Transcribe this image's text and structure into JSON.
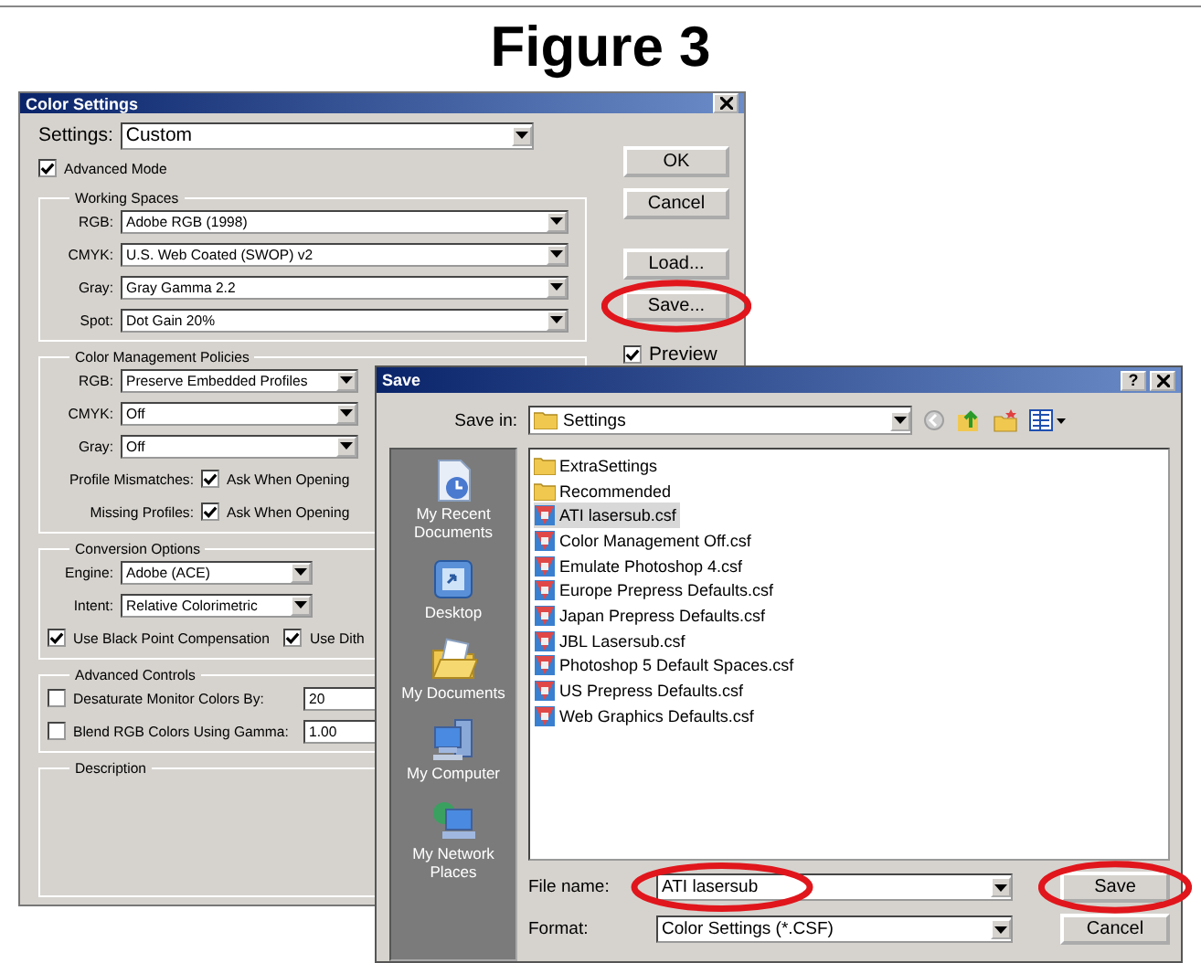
{
  "caption": "Figure 3",
  "color_settings": {
    "title": "Color Settings",
    "settings": {
      "label": "Settings:",
      "value": "Custom"
    },
    "advanced_mode": {
      "label": "Advanced Mode",
      "checked": true
    },
    "working_spaces": {
      "title": "Working Spaces",
      "rows": [
        {
          "label": "RGB:",
          "value": "Adobe RGB (1998)"
        },
        {
          "label": "CMYK:",
          "value": "U.S. Web Coated (SWOP) v2"
        },
        {
          "label": "Gray:",
          "value": "Gray Gamma 2.2"
        },
        {
          "label": "Spot:",
          "value": "Dot Gain 20%"
        }
      ]
    },
    "policies": {
      "title": "Color Management Policies",
      "rows": [
        {
          "label": "RGB:",
          "value": "Preserve Embedded Profiles"
        },
        {
          "label": "CMYK:",
          "value": "Off"
        },
        {
          "label": "Gray:",
          "value": "Off"
        }
      ],
      "checks": [
        {
          "label": "Profile Mismatches:",
          "option": "Ask When Opening",
          "checked": true
        },
        {
          "label": "Missing Profiles:",
          "option": "Ask When Opening",
          "checked": true
        }
      ]
    },
    "conversion": {
      "title": "Conversion Options",
      "rows": [
        {
          "label": "Engine:",
          "value": "Adobe (ACE)"
        },
        {
          "label": "Intent:",
          "value": "Relative Colorimetric"
        }
      ],
      "checks": [
        {
          "label": "Use Black Point Compensation",
          "checked": true
        },
        {
          "label": "Use Dith",
          "checked": true
        }
      ]
    },
    "advanced": {
      "title": "Advanced Controls",
      "rows": [
        {
          "label": "Desaturate Monitor Colors By:",
          "checked": false,
          "value": "20"
        },
        {
          "label": "Blend RGB Colors Using Gamma:",
          "checked": false,
          "value": "1.00"
        }
      ]
    },
    "description": {
      "title": "Description"
    },
    "buttons": [
      {
        "label": "OK",
        "highlighted": false
      },
      {
        "label": "Cancel",
        "highlighted": false
      },
      {
        "label": "Load...",
        "highlighted": false
      },
      {
        "label": "Save...",
        "highlighted": true
      }
    ],
    "preview": {
      "label": "Preview",
      "checked": true
    }
  },
  "save_dialog": {
    "title": "Save",
    "help": "?",
    "save_in": {
      "label": "Save in:",
      "value": "Settings"
    },
    "places": [
      {
        "kind": "recent",
        "label": "My Recent Documents"
      },
      {
        "kind": "desktop",
        "label": "Desktop"
      },
      {
        "kind": "documents",
        "label": "My Documents"
      },
      {
        "kind": "computer",
        "label": "My Computer"
      },
      {
        "kind": "network",
        "label": "My Network Places"
      }
    ],
    "files": [
      {
        "kind": "folder",
        "name": "ExtraSettings",
        "selected": false
      },
      {
        "kind": "folder",
        "name": "Recommended",
        "selected": false
      },
      {
        "kind": "file",
        "name": "ATI lasersub.csf",
        "selected": true
      },
      {
        "kind": "file",
        "name": "Color Management Off.csf",
        "selected": false
      },
      {
        "kind": "file",
        "name": "Emulate Photoshop 4.csf",
        "selected": false
      },
      {
        "kind": "file",
        "name": "Europe Prepress Defaults.csf",
        "selected": false
      },
      {
        "kind": "file",
        "name": "Japan Prepress Defaults.csf",
        "selected": false
      },
      {
        "kind": "file",
        "name": "JBL Lasersub.csf",
        "selected": false
      },
      {
        "kind": "file",
        "name": "Photoshop 5 Default Spaces.csf",
        "selected": false
      },
      {
        "kind": "file",
        "name": "US Prepress Defaults.csf",
        "selected": false
      },
      {
        "kind": "file",
        "name": "Web Graphics Defaults.csf",
        "selected": false
      }
    ],
    "file_name": {
      "label": "File name:",
      "value": "ATI lasersub",
      "highlighted": true
    },
    "format": {
      "label": "Format:",
      "value": "Color Settings (*.CSF)"
    },
    "buttons": [
      {
        "label": "Save",
        "highlighted": true
      },
      {
        "label": "Cancel",
        "highlighted": false
      }
    ]
  }
}
